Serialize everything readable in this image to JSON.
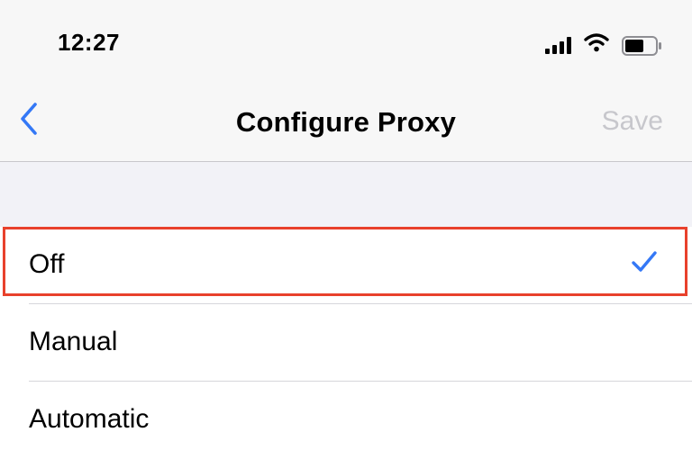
{
  "status_bar": {
    "time": "12:27",
    "icons": [
      "cellular-signal-icon",
      "wifi-icon",
      "battery-icon"
    ]
  },
  "nav": {
    "back_icon": "chevron-left-icon",
    "title": "Configure Proxy",
    "save_label": "Save"
  },
  "options": [
    {
      "label": "Off",
      "selected": true
    },
    {
      "label": "Manual",
      "selected": false
    },
    {
      "label": "Automatic",
      "selected": false
    }
  ],
  "colors": {
    "accent": "#3478f6",
    "disabled": "#c7c7cc",
    "highlight": "#e8412c",
    "background": "#f2f2f7"
  }
}
